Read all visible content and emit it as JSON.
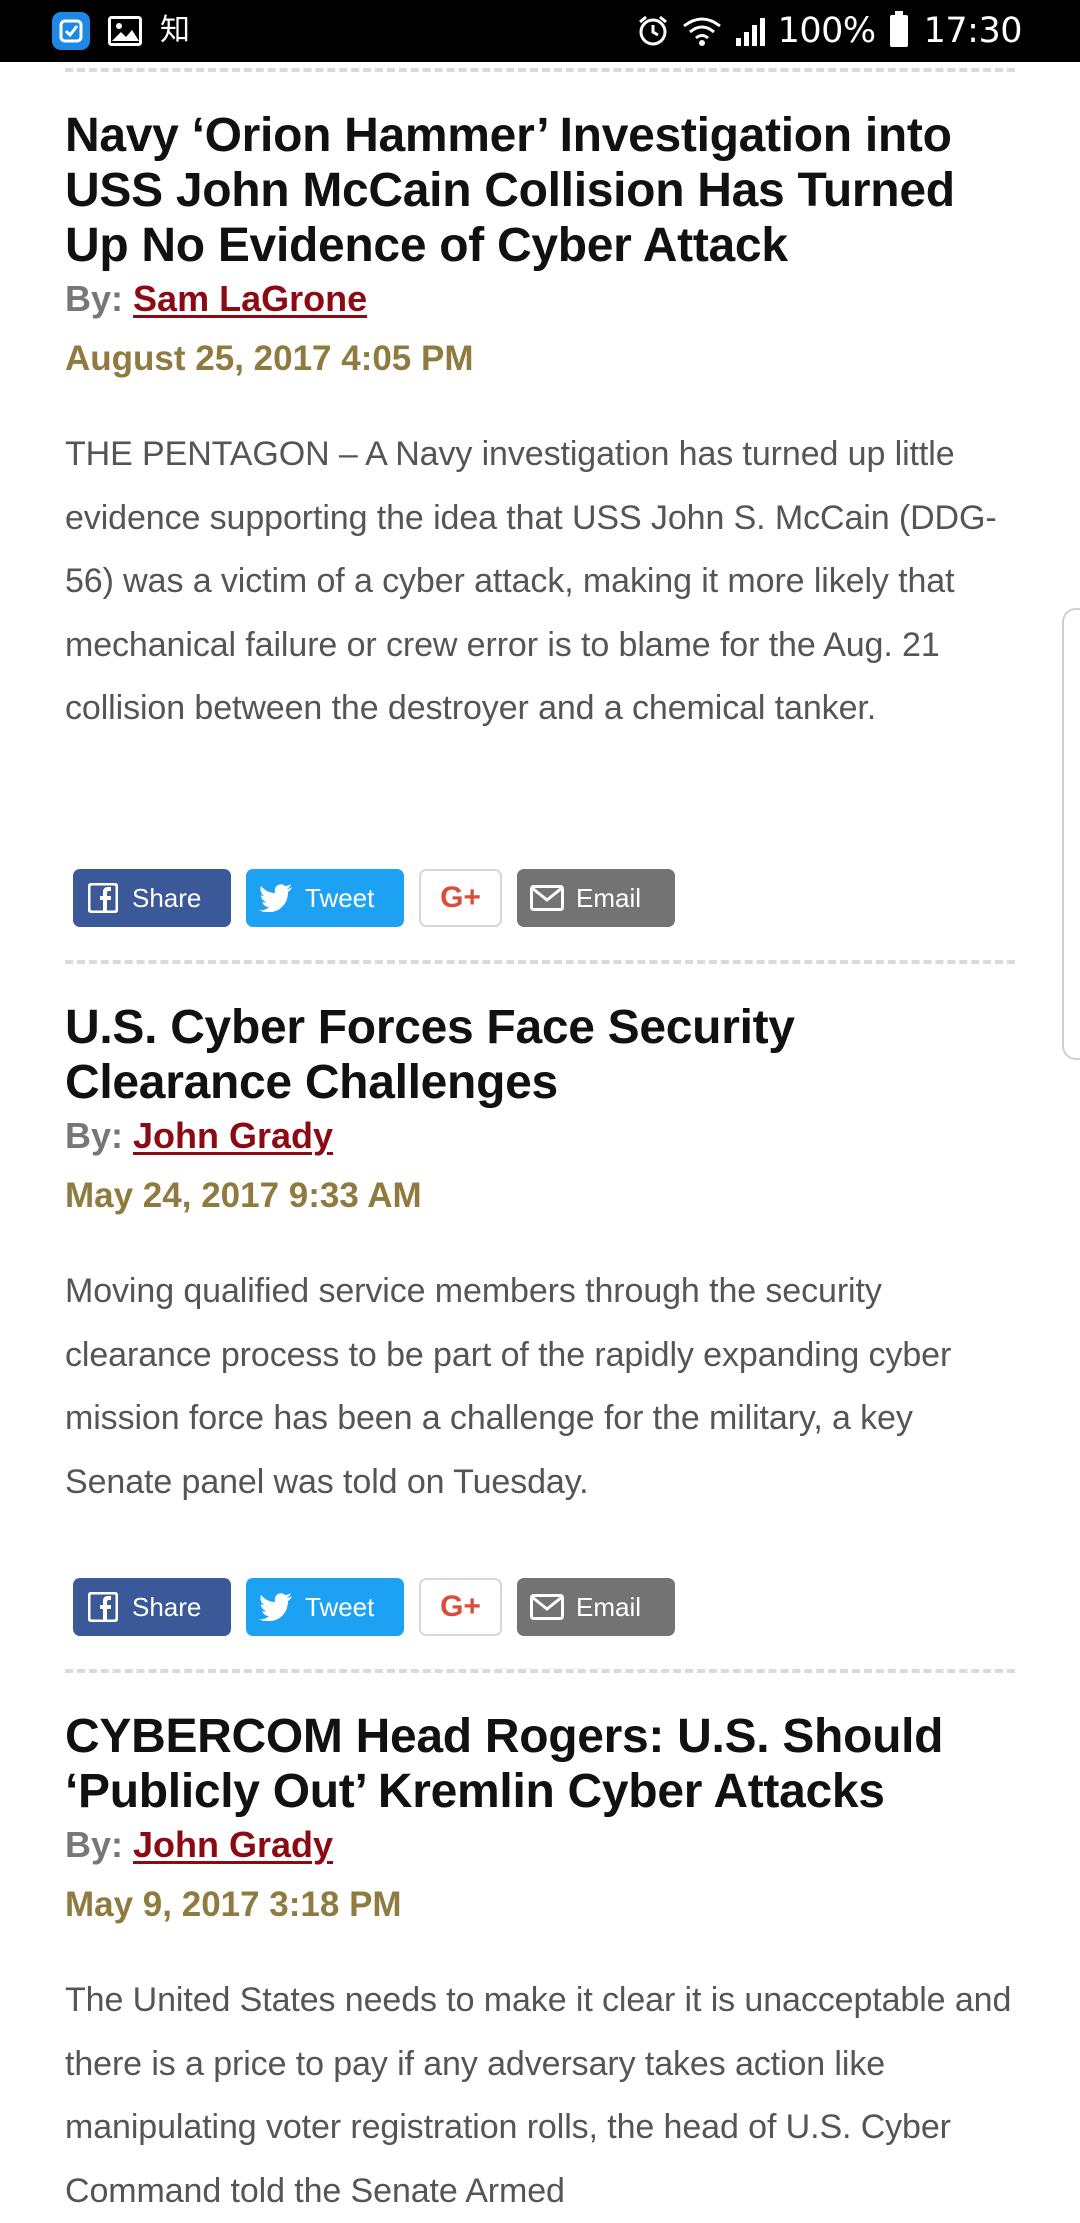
{
  "status_bar": {
    "left_icons": [
      "app-icon",
      "gallery-icon"
    ],
    "left_text": "知",
    "right_icons": [
      "alarm-icon",
      "wifi-icon",
      "signal-icon",
      "battery-icon"
    ],
    "battery": "100%",
    "time": "17:30"
  },
  "articles": [
    {
      "title": "Navy ‘Orion Hammer’ Investigation into USS John McCain Collision Has Turned Up No Evidence of Cyber Attack",
      "by_label": "By:",
      "author": "Sam LaGrone",
      "date": "August 25, 2017 4:05 PM",
      "summary": "THE PENTAGON – A Navy investigation has turned up little evidence supporting the idea that USS John S. McCain (DDG-56) was a victim of a cyber attack, making it more likely that mechanical failure or crew error is to blame for the Aug. 21 collision between the destroyer and a chemical tanker."
    },
    {
      "title": "U.S. Cyber Forces Face Security Clearance Challenges",
      "by_label": "By:",
      "author": "John Grady",
      "date": "May 24, 2017 9:33 AM",
      "summary": "Moving qualified service members through the security clearance process to be part of the rapidly expanding cyber mission force has been a challenge for the military, a key Senate panel was told on Tuesday."
    },
    {
      "title": "CYBERCOM Head Rogers: U.S. Should ‘Publicly Out’ Kremlin Cyber Attacks",
      "by_label": "By:",
      "author": "John Grady",
      "date": "May 9, 2017 3:18 PM",
      "summary": "The United States needs to make it clear it is unacceptable and there is a price to pay if any adversary takes action like manipulating voter registration rolls, the head of U.S. Cyber Command told the Senate Armed"
    }
  ],
  "share": {
    "share_label": "Share",
    "tweet_label": "Tweet",
    "gplus_label": "G+",
    "email_label": "Email"
  },
  "colors": {
    "author_link": "#8b0a14",
    "date": "#8f7b3f",
    "facebook": "#3b5998",
    "twitter": "#1da1f2",
    "gplus": "#dd4b39",
    "email": "#737373"
  }
}
